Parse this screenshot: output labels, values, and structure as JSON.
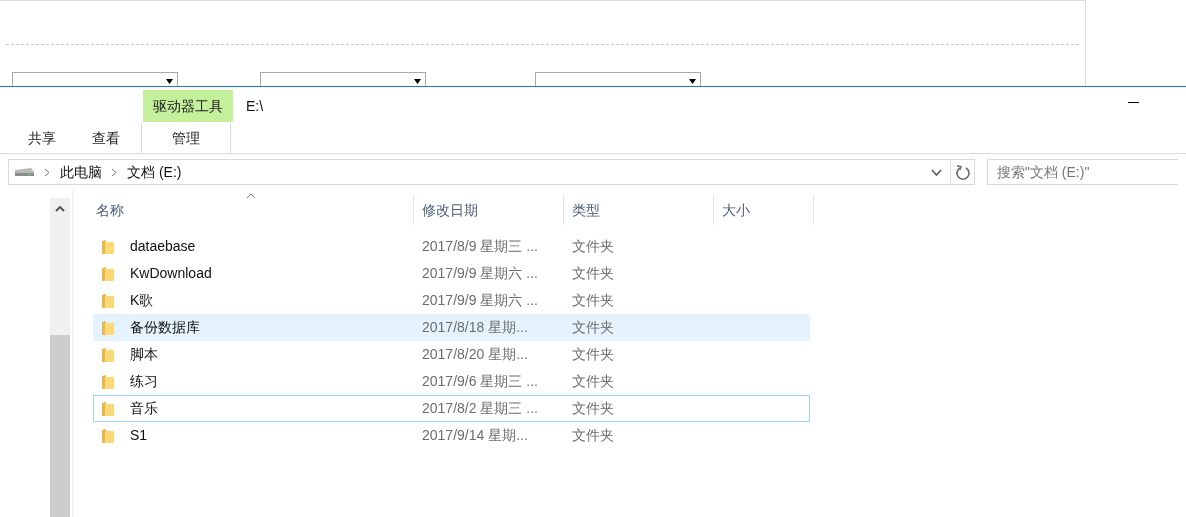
{
  "background_page": {
    "dropdowns": [
      {
        "kind": "select"
      },
      {
        "kind": "select"
      },
      {
        "kind": "select"
      }
    ]
  },
  "window": {
    "title": "E:\\",
    "context_tab": "驱动器工具"
  },
  "ribbon_tabs": [
    {
      "label": "共享",
      "selected": false
    },
    {
      "label": "查看",
      "selected": false
    },
    {
      "label": "管理",
      "selected": true
    }
  ],
  "address_bar": {
    "breadcrumbs": [
      "此电脑",
      "文档 (E:)"
    ]
  },
  "search": {
    "placeholder": "搜索\"文档 (E:)\""
  },
  "table": {
    "columns": [
      "名称",
      "修改日期",
      "类型",
      "大小"
    ],
    "rows": [
      {
        "name": "dataebase",
        "date": "2017/8/9 星期三 ...",
        "type": "文件夹",
        "selected": false,
        "focused": false
      },
      {
        "name": "KwDownload",
        "date": "2017/9/9 星期六 ...",
        "type": "文件夹",
        "selected": false,
        "focused": false
      },
      {
        "name": "K歌",
        "date": "2017/9/9 星期六 ...",
        "type": "文件夹",
        "selected": false,
        "focused": false
      },
      {
        "name": "备份数据库",
        "date": "2017/8/18 星期...",
        "type": "文件夹",
        "selected": true,
        "focused": false
      },
      {
        "name": "脚本",
        "date": "2017/8/20 星期...",
        "type": "文件夹",
        "selected": false,
        "focused": false
      },
      {
        "name": "练习",
        "date": "2017/9/6 星期三 ...",
        "type": "文件夹",
        "selected": false,
        "focused": false
      },
      {
        "name": "音乐",
        "date": "2017/8/2 星期三 ...",
        "type": "文件夹",
        "selected": false,
        "focused": true
      },
      {
        "name": "S1",
        "date": "2017/9/14 星期...",
        "type": "文件夹",
        "selected": false,
        "focused": false
      }
    ]
  }
}
